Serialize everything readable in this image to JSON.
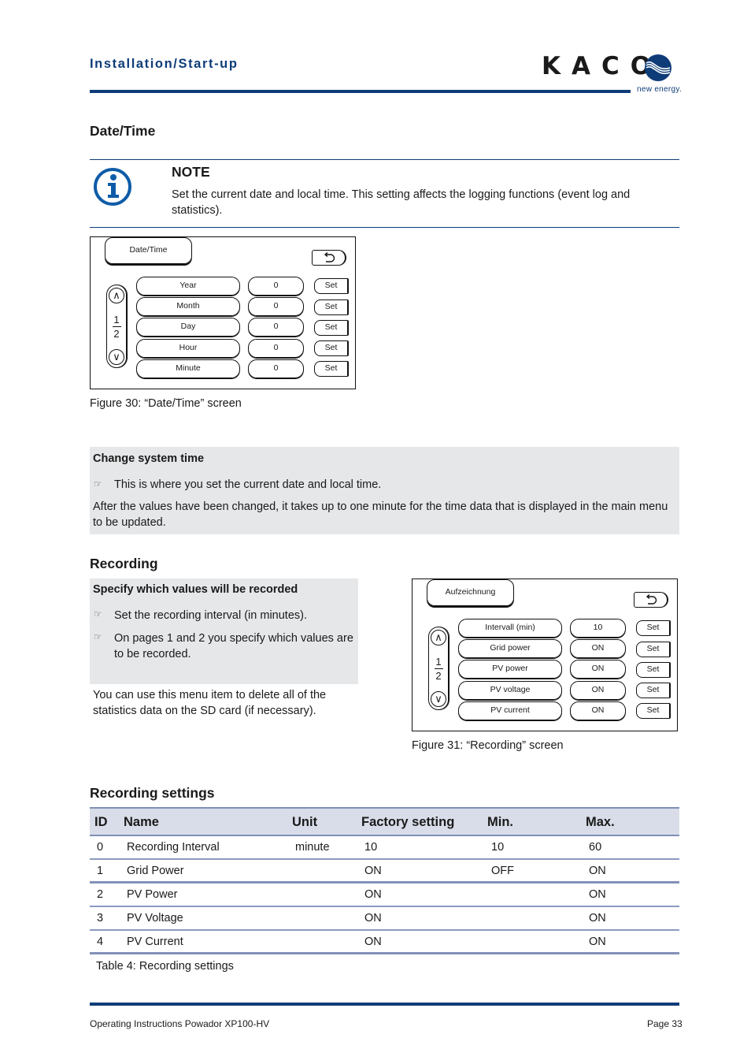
{
  "header": {
    "section_title": "Installation/Start-up",
    "logo_text": "KACO",
    "logo_tagline": "new energy.",
    "brand_color": "#0e3c78"
  },
  "date_time": {
    "heading": "Date/Time",
    "note": {
      "icon": "info-icon",
      "title": "NOTE",
      "text": "Set the current date and local time. This setting affects the logging functions (event log and statistics)."
    },
    "screen": {
      "title": "Date/Time",
      "back_icon": "back-arrow-icon",
      "page_current": "1",
      "page_total": "2",
      "up_icon": "chevron-up-icon",
      "down_icon": "chevron-down-icon",
      "rows": [
        {
          "label": "Year",
          "value": "0",
          "button": "Set"
        },
        {
          "label": "Month",
          "value": "0",
          "button": "Set"
        },
        {
          "label": "Day",
          "value": "0",
          "button": "Set"
        },
        {
          "label": "Hour",
          "value": "0",
          "button": "Set"
        },
        {
          "label": "Minute",
          "value": "0",
          "button": "Set"
        }
      ]
    },
    "caption": "Figure 30:  “Date/Time” screen",
    "instruction": {
      "title": "Change system time",
      "bullet_icon": "pointing-hand-icon",
      "bullets": [
        "This is where you set the current date and local time."
      ],
      "text": "After the values have been changed, it takes up to one minute for the time data that is displayed in the main menu to be updated."
    }
  },
  "recording": {
    "heading": "Recording",
    "instruction": {
      "title": "Specify which values will be recorded",
      "bullets": [
        "Set the recording interval (in minutes).",
        "On pages 1 and 2 you specify which values are to be recorded."
      ]
    },
    "text": "You can use this menu item to delete all of the statistics data on the SD card (if necessary).",
    "screen": {
      "title": "Aufzeichnung",
      "page_current": "1",
      "page_total": "2",
      "rows": [
        {
          "label": "Intervall (min)",
          "value": "10",
          "button": "Set"
        },
        {
          "label": "Grid power",
          "value": "ON",
          "button": "Set"
        },
        {
          "label": "PV power",
          "value": "ON",
          "button": "Set"
        },
        {
          "label": "PV voltage",
          "value": "ON",
          "button": "Set"
        },
        {
          "label": "PV current",
          "value": "ON",
          "button": "Set"
        }
      ]
    },
    "caption": "Figure 31:  “Recording” screen"
  },
  "recording_settings": {
    "heading": "Recording settings",
    "columns": [
      "ID",
      "Name",
      "Unit",
      "Factory setting",
      "Min.",
      "Max."
    ],
    "rows": [
      [
        "0",
        "Recording Interval",
        "minute",
        "10",
        "10",
        "60"
      ],
      [
        "1",
        "Grid Power",
        "",
        "ON",
        "OFF",
        "ON"
      ],
      [
        "2",
        "PV Power",
        "",
        "ON",
        "",
        "ON"
      ],
      [
        "3",
        "PV Voltage",
        "",
        "ON",
        "",
        "ON"
      ],
      [
        "4",
        "PV Current",
        "",
        "ON",
        "",
        "ON"
      ]
    ],
    "caption": "Table 4:  Recording settings"
  },
  "footer": {
    "document": "Operating Instructions Powador XP100-HV",
    "page": "Page 33"
  }
}
